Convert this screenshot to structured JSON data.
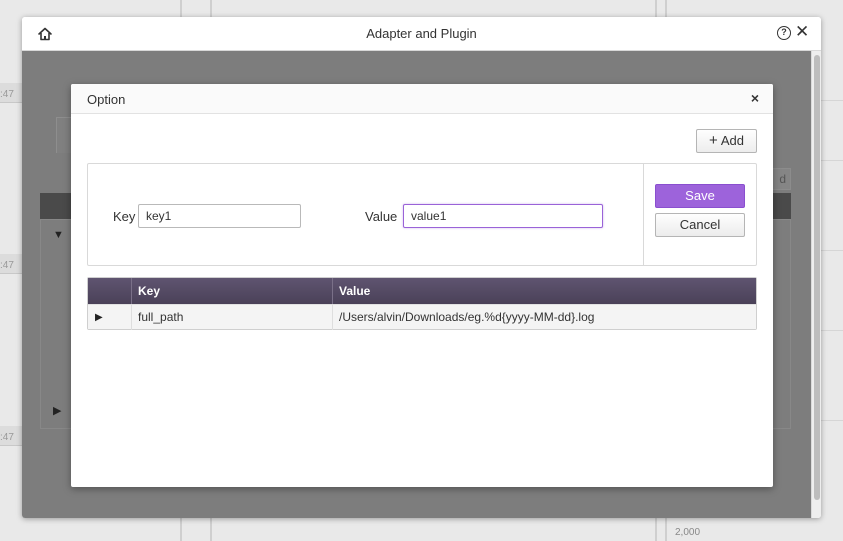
{
  "background": {
    "side_labels": [
      ":47",
      ":47",
      ":47"
    ],
    "corner_label": "2,000",
    "partial_button_label": "d"
  },
  "outer_dialog": {
    "title": "Adapter and Plugin",
    "home_icon": "home-icon",
    "help_icon": "help-icon",
    "help_glyph": "?",
    "close_glyph": "✕"
  },
  "option_dialog": {
    "title": "Option",
    "close_glyph": "×",
    "add_button": {
      "plus": "+",
      "label": "Add"
    },
    "form": {
      "key_label": "Key",
      "key_value": "key1",
      "value_label": "Value",
      "value_value": "value1"
    },
    "save_label": "Save",
    "cancel_label": "Cancel",
    "accent_color": "#9d63db",
    "table": {
      "columns": [
        "Key",
        "Value"
      ],
      "rows": [
        {
          "expander": "▶",
          "key": "full_path",
          "value": "/Users/alvin/Downloads/eg.%d{yyyy-MM-dd}.log"
        }
      ]
    }
  }
}
